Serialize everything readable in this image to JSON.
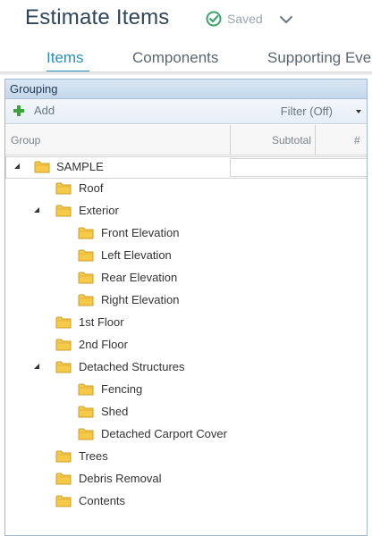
{
  "header": {
    "title": "Estimate Items",
    "status": "Saved",
    "status_icon": "check-circle-icon",
    "chevron_icon": "chevron-down-icon"
  },
  "tabs": [
    {
      "label": "Items",
      "active": true
    },
    {
      "label": "Components",
      "active": false
    },
    {
      "label": "Supporting Eve",
      "active": false
    }
  ],
  "panel": {
    "title": "Grouping",
    "toolbar": {
      "add_label": "Add",
      "add_icon": "plus-icon",
      "filter_label": "Filter (Off)"
    },
    "columns": {
      "group": "Group",
      "subtotal": "Subtotal",
      "count": "#"
    },
    "tree": {
      "root": "SAMPLE",
      "items": [
        {
          "label": "Roof",
          "level": 1,
          "expanded": null
        },
        {
          "label": "Exterior",
          "level": 1,
          "expanded": true
        },
        {
          "label": "Front Elevation",
          "level": 2,
          "expanded": null
        },
        {
          "label": "Left Elevation",
          "level": 2,
          "expanded": null
        },
        {
          "label": "Rear Elevation",
          "level": 2,
          "expanded": null
        },
        {
          "label": "Right Elevation",
          "level": 2,
          "expanded": null
        },
        {
          "label": "1st Floor",
          "level": 1,
          "expanded": null
        },
        {
          "label": "2nd Floor",
          "level": 1,
          "expanded": null
        },
        {
          "label": "Detached Structures",
          "level": 1,
          "expanded": true
        },
        {
          "label": "Fencing",
          "level": 2,
          "expanded": null
        },
        {
          "label": "Shed",
          "level": 2,
          "expanded": null
        },
        {
          "label": "Detached Carport Cover",
          "level": 2,
          "expanded": null
        },
        {
          "label": "Trees",
          "level": 1,
          "expanded": null
        },
        {
          "label": "Debris Removal",
          "level": 1,
          "expanded": null
        },
        {
          "label": "Contents",
          "level": 1,
          "expanded": null
        }
      ]
    }
  },
  "colors": {
    "accent": "#2a8fb8",
    "title": "#2f4559",
    "saved_check": "#3aa36a",
    "folder": "#f7c948",
    "add_plus": "#3aa33a"
  }
}
